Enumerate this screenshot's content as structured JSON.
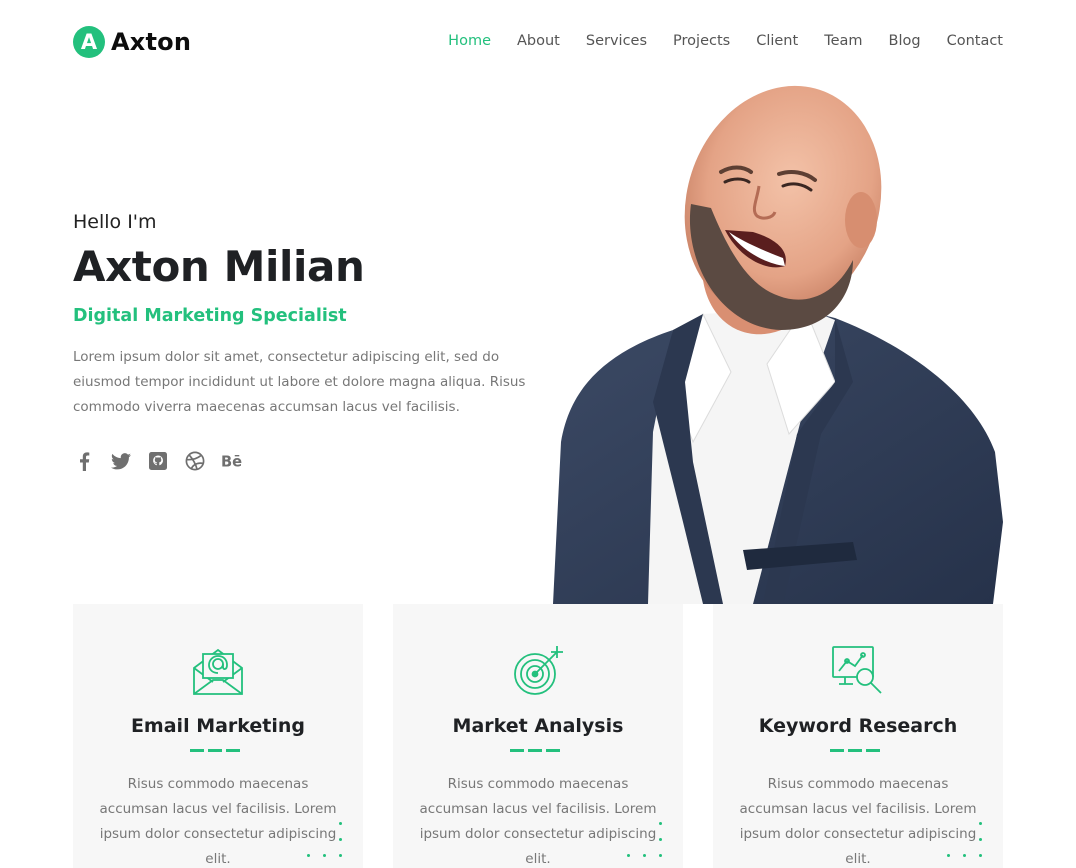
{
  "brand": {
    "logo_letter": "A",
    "name": "Axton",
    "accent": "#23c07d"
  },
  "nav": {
    "items": [
      {
        "label": "Home",
        "active": true
      },
      {
        "label": "About"
      },
      {
        "label": "Services"
      },
      {
        "label": "Projects"
      },
      {
        "label": "Client"
      },
      {
        "label": "Team"
      },
      {
        "label": "Blog"
      },
      {
        "label": "Contact"
      }
    ]
  },
  "hero": {
    "greeting": "Hello I'm",
    "name": "Axton Milian",
    "role": "Digital Marketing Specialist",
    "bio": "Lorem ipsum dolor sit amet, consectetur adipiscing elit, sed do eiusmod tempor incididunt ut labore et dolore magna aliqua. Risus commodo viverra maecenas accumsan lacus vel facilisis.",
    "social": [
      {
        "icon": "facebook-icon"
      },
      {
        "icon": "twitter-icon"
      },
      {
        "icon": "github-icon"
      },
      {
        "icon": "dribbble-icon"
      },
      {
        "icon": "behance-icon"
      }
    ]
  },
  "services": [
    {
      "icon": "email-marketing-icon",
      "title": "Email Marketing",
      "text": "Risus commodo maecenas accumsan lacus vel facilisis. Lorem ipsum dolor consectetur adipiscing elit."
    },
    {
      "icon": "target-icon",
      "title": "Market Analysis",
      "text": "Risus commodo maecenas accumsan lacus vel facilisis. Lorem ipsum dolor consectetur adipiscing elit."
    },
    {
      "icon": "keyword-research-icon",
      "title": "Keyword Research",
      "text": "Risus commodo maecenas accumsan lacus vel facilisis. Lorem ipsum dolor consectetur adipiscing elit."
    }
  ]
}
